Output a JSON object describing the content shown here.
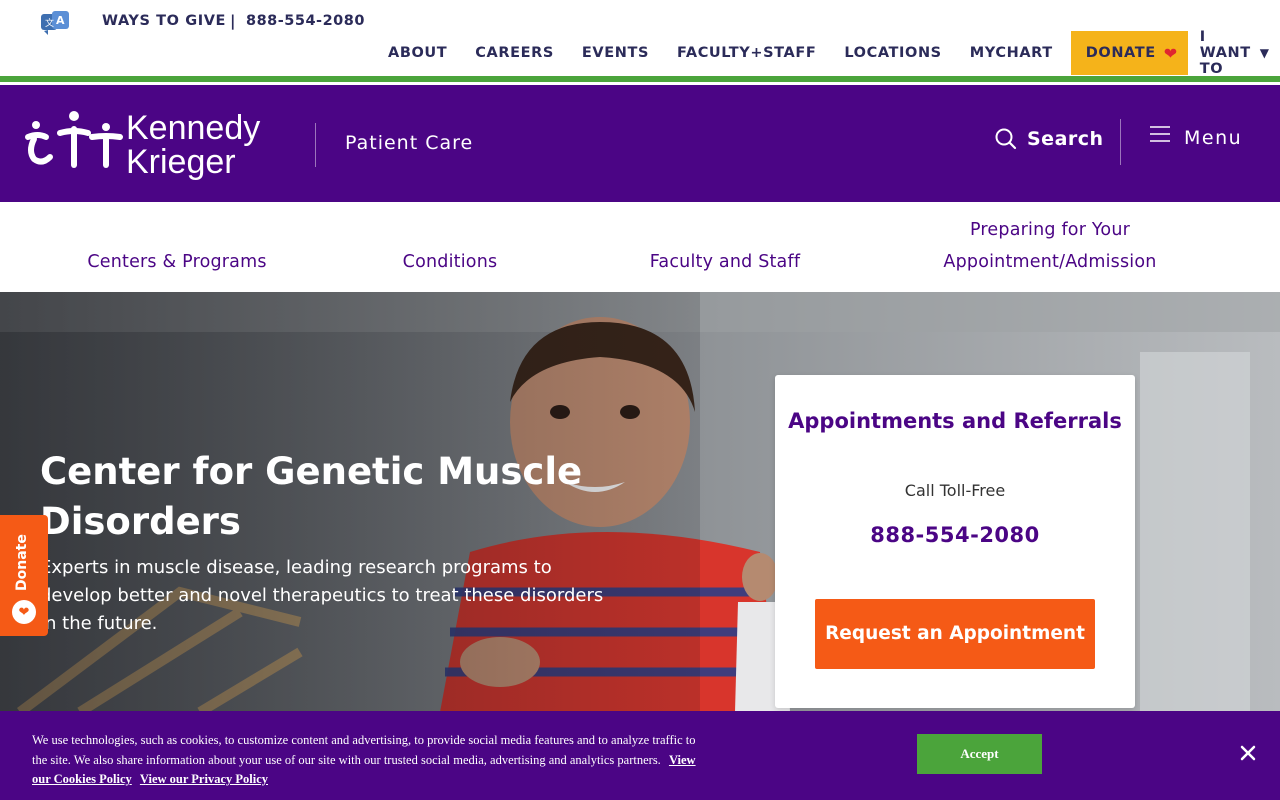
{
  "topbar": {
    "ways_to_give": "WAYS TO GIVE",
    "separator": "|",
    "phone": "888-554-2080",
    "nav": [
      "ABOUT",
      "CAREERS",
      "EVENTS",
      "FACULTY+STAFF",
      "LOCATIONS",
      "MYCHART"
    ],
    "donate": "DONATE",
    "i_want_to": "I WANT TO",
    "icons": {
      "translate": "translate-icon",
      "heart": "heart-icon",
      "caret": "caret-down-icon"
    },
    "colors": {
      "donate_bg": "#f5b31a",
      "heart": "#e0262f",
      "accent_line": "#4ba43b"
    }
  },
  "header": {
    "logo_line1": "Kennedy",
    "logo_line2": "Krieger",
    "section": "Patient Care",
    "search": "Search",
    "menu": "Menu",
    "colors": {
      "bg": "#4b0585"
    }
  },
  "subnav": {
    "items": [
      "Centers & Programs",
      "Conditions",
      "Faculty and Staff",
      "Preparing for Your Appointment/Admission"
    ]
  },
  "hero": {
    "title": "Center for Genetic Muscle Disorders",
    "description": "Experts in muscle disease, leading research programs to develop better and novel therapeutics to treat these disorders in the future."
  },
  "card": {
    "title": "Appointments and Referrals",
    "subtitle": "Call Toll-Free",
    "phone": "888-554-2080",
    "button": "Request an Appointment",
    "colors": {
      "button_bg": "#f55a16"
    }
  },
  "side_tab": {
    "label": "Donate"
  },
  "cookie": {
    "text": "We use technologies, such as cookies, to customize content and advertising, to provide social media features and to analyze traffic to the site. We also share information about your use of our site with our trusted social media, advertising and analytics partners.",
    "cookies_link": "View our Cookies Policy",
    "privacy_link": "View our Privacy Policy",
    "accept": "Accept",
    "close_icon": "close-icon"
  }
}
